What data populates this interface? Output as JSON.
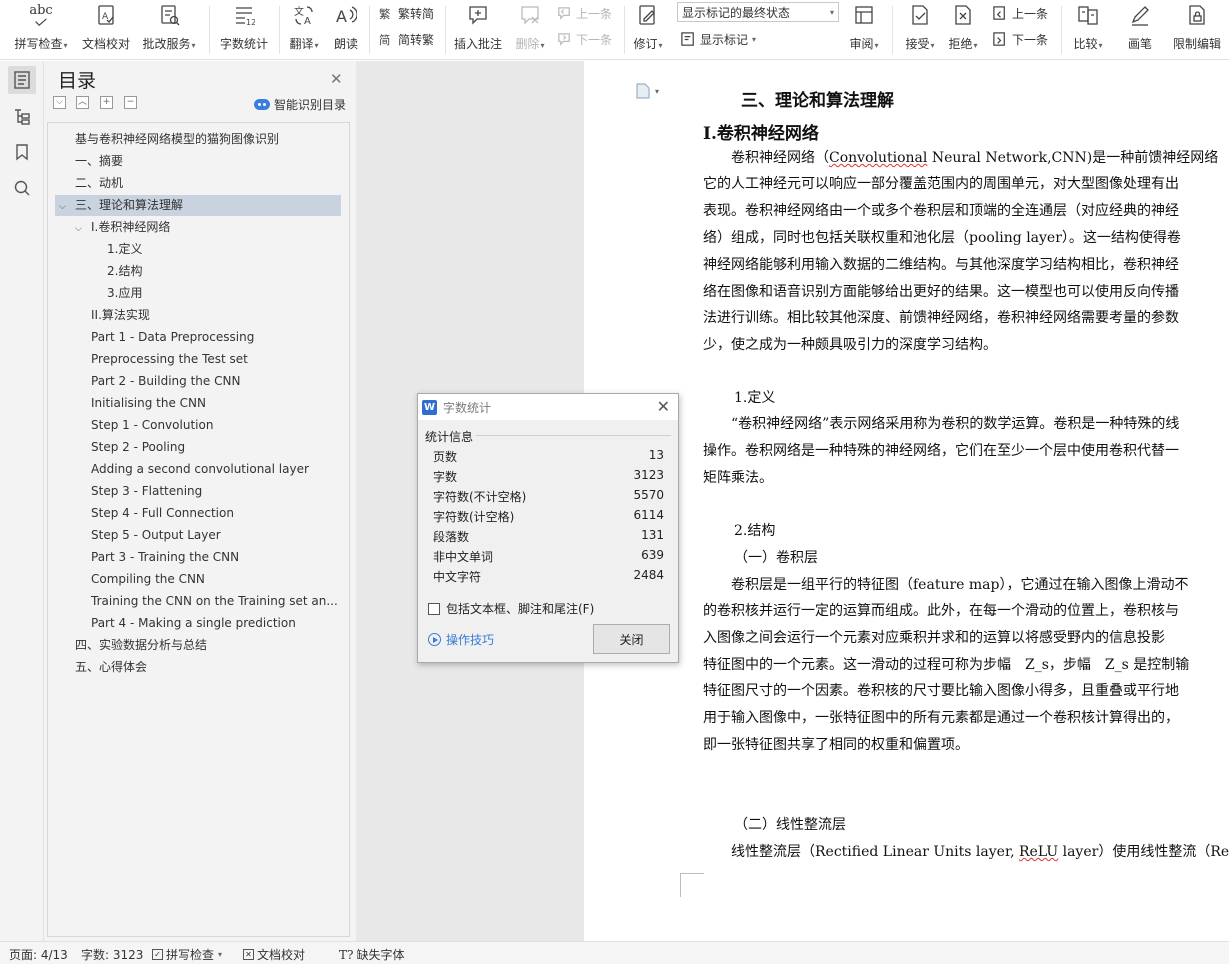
{
  "ribbon": {
    "spell_check": "拼写检查",
    "doc_proof": "文档校对",
    "review_service": "批改服务",
    "word_count": "字数统计",
    "translate": "翻译",
    "read_aloud": "朗读",
    "trad_to_simp": "繁转简",
    "simp_to_trad": "简转繁",
    "insert_comment": "插入批注",
    "delete": "删除",
    "prev_comment": "上一条",
    "next_comment": "下一条",
    "track_changes": "修订",
    "markup_dropdown": "显示标记的最终状态",
    "show_markup": "显示标记",
    "review": "审阅",
    "accept": "接受",
    "reject": "拒绝",
    "prev_change": "上一条",
    "next_change": "下一条",
    "compare": "比较",
    "ink": "画笔",
    "restrict_edit": "限制编辑",
    "abc": "abc"
  },
  "toc": {
    "title": "目录",
    "smart_toc": "智能识别目录",
    "items": [
      {
        "label": "基与卷积神经网络模型的猫狗图像识别"
      },
      {
        "label": "一、摘要"
      },
      {
        "label": "二、动机"
      },
      {
        "label": "三、理论和算法理解",
        "expander": "⌵"
      },
      {
        "label": "I.卷积神经网络",
        "expander": "⌵"
      },
      {
        "label": "1.定义"
      },
      {
        "label": "2.结构"
      },
      {
        "label": "3.应用"
      },
      {
        "label": "II.算法实现"
      },
      {
        "label": "Part 1 - Data Preprocessing"
      },
      {
        "label": "Preprocessing the Test set"
      },
      {
        "label": "Part 2 - Building the CNN"
      },
      {
        "label": "Initialising the CNN"
      },
      {
        "label": "Step 1 - Convolution"
      },
      {
        "label": "Step 2 - Pooling"
      },
      {
        "label": "Adding a second convolutional layer"
      },
      {
        "label": "Step 3 - Flattening"
      },
      {
        "label": "Step 4 - Full Connection"
      },
      {
        "label": "Step 5 - Output Layer"
      },
      {
        "label": "Part 3 - Training the CNN"
      },
      {
        "label": "Compiling the CNN"
      },
      {
        "label": "Training the CNN on the Training set an..."
      },
      {
        "label": "Part 4 - Making a single prediction"
      },
      {
        "label": "四、实验数据分析与总结"
      },
      {
        "label": "五、心得体会"
      }
    ]
  },
  "document": {
    "h2": "三、理论和算法理解",
    "h3": "I.卷积神经网络",
    "p1": [
      "　　卷积神经网络（",
      "Convolutional",
      " Neural Network,CNN)是一种前馈神经网络",
      "它的人工神经元可以响应一部分覆盖范围内的周围单元，对大型图像处理有出",
      "表现。卷积神经网络由一个或多个卷积层和顶端的全连通层（对应经典的神经",
      "络）组成，同时也包括关联权重和池化层（pooling layer）。这一结构使得卷",
      "神经网络能够利用输入数据的二维结构。与其他深度学习结构相比，卷积神经",
      "络在图像和语音识别方面能够给出更好的结果。这一模型也可以使用反向传播",
      "法进行训练。相比较其他深度、前馈神经网络，卷积神经网络需要考量的参数",
      "少，使之成为一种颇具吸引力的深度学习结构。"
    ],
    "s1_title": "1.定义",
    "p2": [
      "　　“卷积神经网络”表示网络采用称为卷积的数学运算。卷积是一种特殊的线",
      "操作。卷积网络是一种特殊的神经网络，它们在至少一个层中使用卷积代替一",
      "矩阵乘法。"
    ],
    "s2_title": "2.结构",
    "s2_sub": "（一）卷积层",
    "p3": [
      "　　卷积层是一组平行的特征图（feature map），它通过在输入图像上滑动不",
      "的卷积核并运行一定的运算而组成。此外，在每一个滑动的位置上，卷积核与",
      "入图像之间会运行一个元素对应乘积并求和的运算以将感受野内的信息投影",
      "特征图中的一个元素。这一滑动的过程可称为步幅　Z_s，步幅　Z_s 是控制输",
      "特征图尺寸的一个因素。卷积核的尺寸要比输入图像小得多，且重叠或平行地",
      "用于输入图像中，一张特征图中的所有元素都是通过一个卷积核计算得出的，",
      "即一张特征图共享了相同的权重和偏置项。"
    ],
    "s3_sub": "（二）线性整流层",
    "p4_a": "　　线性整流层（Rectified Linear Units layer, ",
    "p4_b": "ReLU",
    "p4_c": " layer）使用线性整流（Rect"
  },
  "dialog": {
    "title": "字数统计",
    "group": "统计信息",
    "stats": [
      {
        "label": "页数",
        "value": "13"
      },
      {
        "label": "字数",
        "value": "3123"
      },
      {
        "label": "字符数(不计空格)",
        "value": "5570"
      },
      {
        "label": "字符数(计空格)",
        "value": "6114"
      },
      {
        "label": "段落数",
        "value": "131"
      },
      {
        "label": "非中文单词",
        "value": "639"
      },
      {
        "label": "中文字符",
        "value": "2484"
      }
    ],
    "checkbox": "包括文本框、脚注和尾注(F)",
    "tips": "操作技巧",
    "close": "关闭",
    "logo": "W"
  },
  "statusbar": {
    "page": "页面: 4/13",
    "words": "字数: 3123",
    "spell": "拼写检查",
    "proof": "文档校对",
    "missing_font": "缺失字体"
  },
  "colors": {
    "accent": "#2f6dd1",
    "toc_selected": "#c8d3df",
    "link": "#3a7bd5"
  }
}
